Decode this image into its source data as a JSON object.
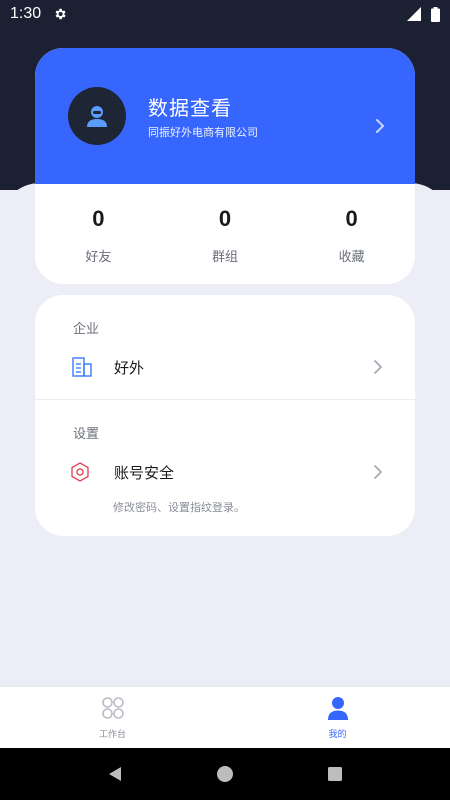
{
  "status_bar": {
    "time": "1:30"
  },
  "profile": {
    "name": "数据查看",
    "company": "同振好外电商有限公司"
  },
  "stats": [
    {
      "value": "0",
      "label": "好友"
    },
    {
      "value": "0",
      "label": "群组"
    },
    {
      "value": "0",
      "label": "收藏"
    }
  ],
  "menu": {
    "enterprise_section": "企业",
    "enterprise_item": "好外",
    "settings_section": "设置",
    "security_item": "账号安全",
    "security_desc": "修改密码、设置指纹登录。"
  },
  "tabbar": {
    "tabs": [
      {
        "label": "工作台",
        "icon": "grid-icon",
        "active": false
      },
      {
        "label": "我的",
        "icon": "user-icon",
        "active": true
      }
    ]
  },
  "colors": {
    "primary": "#3766FF",
    "dark_bg": "#1B2032",
    "page_bg": "#ECEDF6",
    "danger_icon": "#E0485A"
  }
}
